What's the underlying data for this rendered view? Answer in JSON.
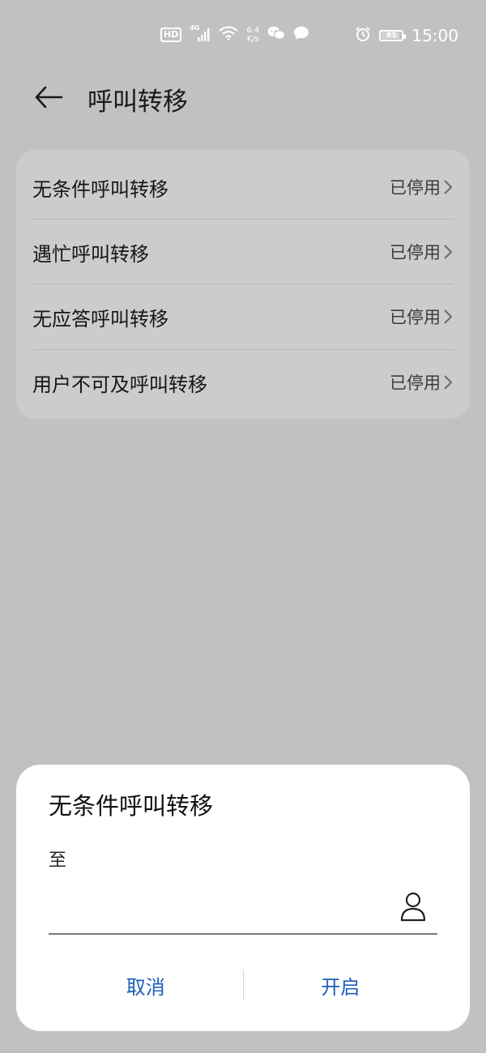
{
  "status_bar": {
    "hd": "HD",
    "signal_label": "4G",
    "net_speed_top": "6.4",
    "net_speed_bottom": "K/s",
    "battery_level": "85",
    "time": "15:00",
    "icons": [
      "hd-icon",
      "signal-icon",
      "wifi-icon",
      "wechat-icon",
      "message-icon",
      "alarm-icon",
      "battery-icon"
    ]
  },
  "header": {
    "title": "呼叫转移",
    "back_icon": "arrow-left-icon"
  },
  "forwarding_options": [
    {
      "label": "无条件呼叫转移",
      "status": "已停用"
    },
    {
      "label": "遇忙呼叫转移",
      "status": "已停用"
    },
    {
      "label": "无应答呼叫转移",
      "status": "已停用"
    },
    {
      "label": "用户不可及呼叫转移",
      "status": "已停用"
    }
  ],
  "dialog": {
    "title": "无条件呼叫转移",
    "subtitle": "至",
    "input_value": "",
    "contact_icon": "person-icon",
    "cancel_label": "取消",
    "confirm_label": "开启"
  },
  "colors": {
    "background_dim": "#c1c1c1",
    "card": "#cccccc",
    "accent": "#1d5fb8",
    "dialog_bg": "#ffffff"
  }
}
